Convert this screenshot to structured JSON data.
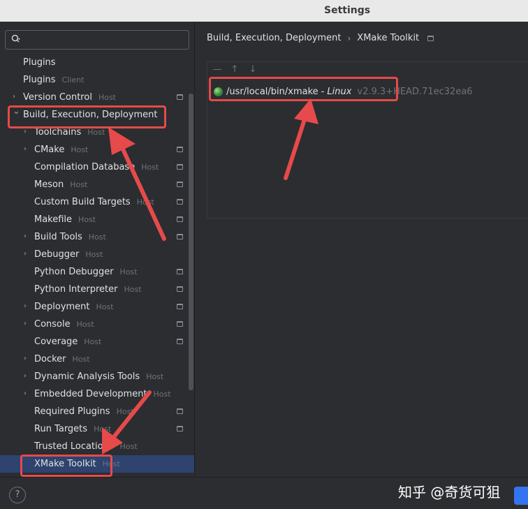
{
  "window": {
    "title": "Settings"
  },
  "sidebar": {
    "search": {
      "placeholder": ""
    },
    "items": [
      {
        "label": "Plugins",
        "tag": "",
        "indent": 0,
        "chevron": "",
        "pin": false
      },
      {
        "label": "Plugins",
        "tag": "Client",
        "indent": 0,
        "chevron": "",
        "pin": false
      },
      {
        "label": "Version Control",
        "tag": "Host",
        "indent": 0,
        "chevron": "right",
        "pin": true
      },
      {
        "label": "Build, Execution, Deployment",
        "tag": "",
        "indent": 0,
        "chevron": "down",
        "pin": false
      },
      {
        "label": "Toolchains",
        "tag": "Host",
        "indent": 1,
        "chevron": "right",
        "pin": false
      },
      {
        "label": "CMake",
        "tag": "Host",
        "indent": 1,
        "chevron": "right",
        "pin": true
      },
      {
        "label": "Compilation Database",
        "tag": "Host",
        "indent": 1,
        "chevron": "",
        "pin": true
      },
      {
        "label": "Meson",
        "tag": "Host",
        "indent": 1,
        "chevron": "",
        "pin": true
      },
      {
        "label": "Custom Build Targets",
        "tag": "Host",
        "indent": 1,
        "chevron": "",
        "pin": true
      },
      {
        "label": "Makefile",
        "tag": "Host",
        "indent": 1,
        "chevron": "",
        "pin": true
      },
      {
        "label": "Build Tools",
        "tag": "Host",
        "indent": 1,
        "chevron": "right",
        "pin": true
      },
      {
        "label": "Debugger",
        "tag": "Host",
        "indent": 1,
        "chevron": "right",
        "pin": false
      },
      {
        "label": "Python Debugger",
        "tag": "Host",
        "indent": 1,
        "chevron": "",
        "pin": true
      },
      {
        "label": "Python Interpreter",
        "tag": "Host",
        "indent": 1,
        "chevron": "",
        "pin": true
      },
      {
        "label": "Deployment",
        "tag": "Host",
        "indent": 1,
        "chevron": "right",
        "pin": true
      },
      {
        "label": "Console",
        "tag": "Host",
        "indent": 1,
        "chevron": "right",
        "pin": true
      },
      {
        "label": "Coverage",
        "tag": "Host",
        "indent": 1,
        "chevron": "",
        "pin": true
      },
      {
        "label": "Docker",
        "tag": "Host",
        "indent": 1,
        "chevron": "right",
        "pin": false
      },
      {
        "label": "Dynamic Analysis Tools",
        "tag": "Host",
        "indent": 1,
        "chevron": "right",
        "pin": false
      },
      {
        "label": "Embedded Development",
        "tag": "Host",
        "indent": 1,
        "chevron": "right",
        "pin": false
      },
      {
        "label": "Required Plugins",
        "tag": "Host",
        "indent": 1,
        "chevron": "",
        "pin": true
      },
      {
        "label": "Run Targets",
        "tag": "Host",
        "indent": 1,
        "chevron": "",
        "pin": true
      },
      {
        "label": "Trusted Locations",
        "tag": "Host",
        "indent": 1,
        "chevron": "",
        "pin": false
      },
      {
        "label": "XMake Toolkit",
        "tag": "Host",
        "indent": 1,
        "chevron": "",
        "pin": false,
        "selected": true
      }
    ]
  },
  "main": {
    "breadcrumb": {
      "parent": "Build, Execution, Deployment",
      "separator": "›",
      "current": "XMake Toolkit"
    },
    "toolbar": {
      "remove": "—",
      "move_up": "↑",
      "move_down": "↓"
    },
    "toolkits": [
      {
        "path": "/usr/local/bin/xmake",
        "dash": "-",
        "os": "Linux",
        "version": "v2.9.3+HEAD.71ec32ea6",
        "icon": "globe-icon"
      }
    ]
  },
  "footer": {
    "help": "?",
    "watermark": "知乎 @奇货可狙"
  },
  "colors": {
    "highlight": "#e64a4a",
    "selection": "#2e436e",
    "accent": "#3574f0"
  }
}
